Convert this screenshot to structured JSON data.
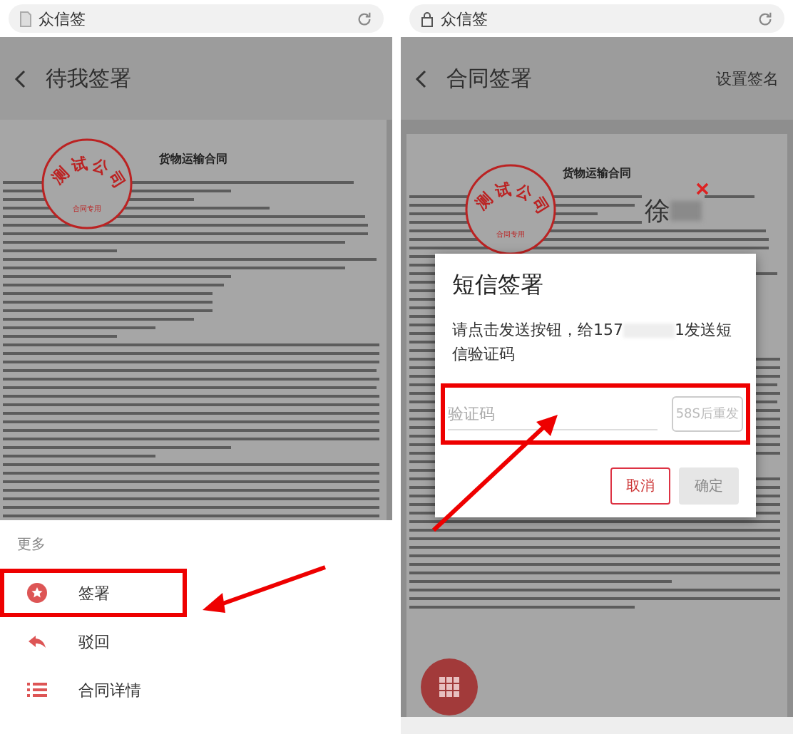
{
  "left_screen": {
    "browser_bar": {
      "title": "众信签"
    },
    "header": {
      "title": "待我签署"
    },
    "document": {
      "title": "货物运输合同",
      "stamp": {
        "text": "测试公司",
        "subtext": "合同专用"
      }
    },
    "sheet": {
      "heading": "更多",
      "items": [
        {
          "label": "签署",
          "kind": "sign",
          "highlighted": true
        },
        {
          "label": "驳回",
          "kind": "reject",
          "highlighted": false
        },
        {
          "label": "合同详情",
          "kind": "details",
          "highlighted": false
        }
      ]
    }
  },
  "right_screen": {
    "browser_bar": {
      "title": "众信签"
    },
    "header": {
      "title": "合同签署",
      "action": "设置签名"
    },
    "document": {
      "title": "货物运输合同",
      "stamp": {
        "text": "测试公司",
        "subtext": "合同专用"
      },
      "signature": "徐"
    },
    "dialog": {
      "title": "短信签署",
      "message_start": "请点击发送按钮，给157",
      "message_end": "1发送短信验证码",
      "code_field": {
        "placeholder": "验证码",
        "highlighted": true
      },
      "resend_button": {
        "label": "58S后重发",
        "disabled": true
      },
      "buttons": [
        {
          "label": "取消",
          "disabled": false
        },
        {
          "label": "确定",
          "disabled": true
        }
      ]
    }
  }
}
